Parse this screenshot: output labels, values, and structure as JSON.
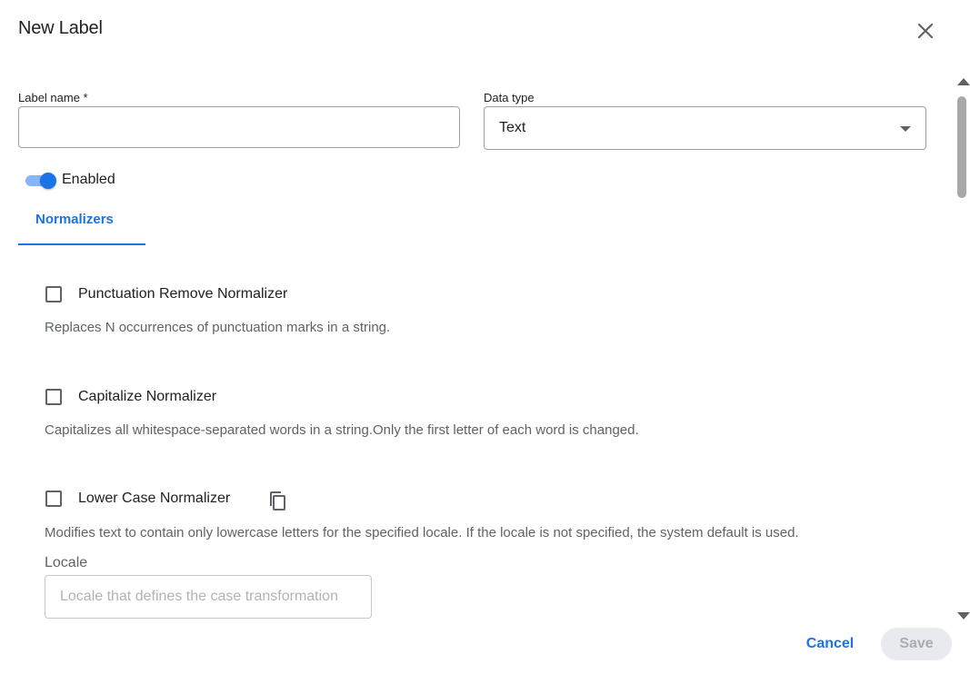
{
  "dialog": {
    "title": "New Label",
    "close_icon": "close-icon"
  },
  "form": {
    "label_name": {
      "label": "Label name *",
      "value": ""
    },
    "data_type": {
      "label": "Data type",
      "value": "Text"
    }
  },
  "enabled_toggle": {
    "label": "Enabled",
    "checked": true
  },
  "tabs": [
    {
      "label": "Normalizers",
      "active": true
    }
  ],
  "normalizers": [
    {
      "title": "Punctuation Remove Normalizer",
      "description": "Replaces N occurrences of punctuation marks in a string.",
      "checked": false
    },
    {
      "title": "Capitalize Normalizer",
      "description": "Capitalizes all whitespace-separated words in a string.Only the first letter of each word is changed.",
      "checked": false
    },
    {
      "title": "Lower Case Normalizer",
      "description": "Modifies text to contain only lowercase letters for the specified locale. If the locale is not specified, the system default is used.",
      "checked": false,
      "icon": "copy-icon",
      "locale": {
        "label": "Locale",
        "placeholder": "Locale that defines the case transformation",
        "value": ""
      }
    }
  ],
  "footer": {
    "cancel_label": "Cancel",
    "save_label": "Save"
  },
  "colors": {
    "accent": "#1a73e8",
    "toggle_track": "#8ab4f8",
    "text_primary": "#202124",
    "text_secondary": "#5f6368",
    "disabled_bg": "#e8eaed"
  }
}
